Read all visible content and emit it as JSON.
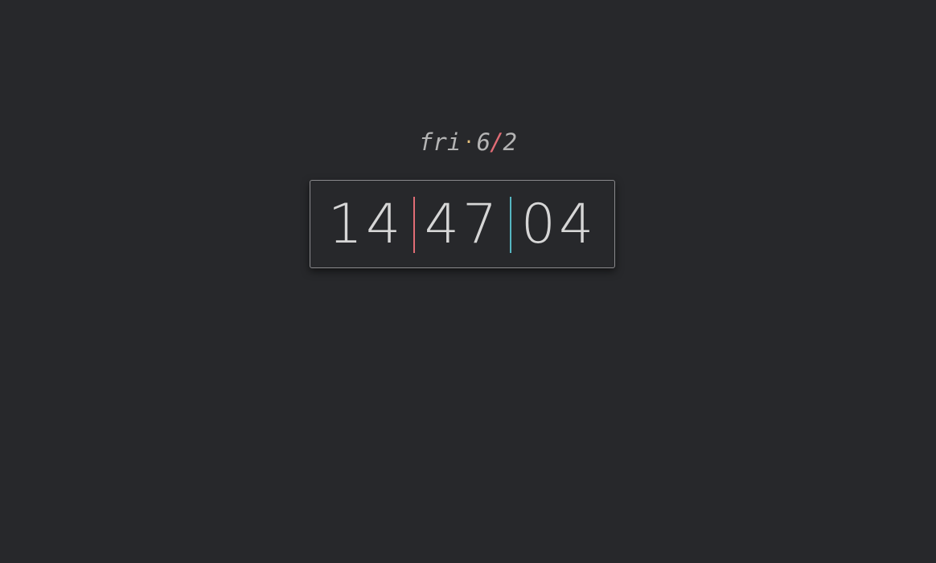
{
  "date": {
    "weekday": "fri",
    "separator": "·",
    "month": "6",
    "slash": "/",
    "day": "2"
  },
  "clock": {
    "hours": "14",
    "minutes": "47",
    "seconds": "04"
  },
  "colors": {
    "background": "#27282b",
    "text": "#d6d6d6",
    "dot_accent": "#e5c07b",
    "slash_accent": "#e06c75",
    "separator_one": "#e06c75",
    "separator_two": "#56b6c2"
  }
}
